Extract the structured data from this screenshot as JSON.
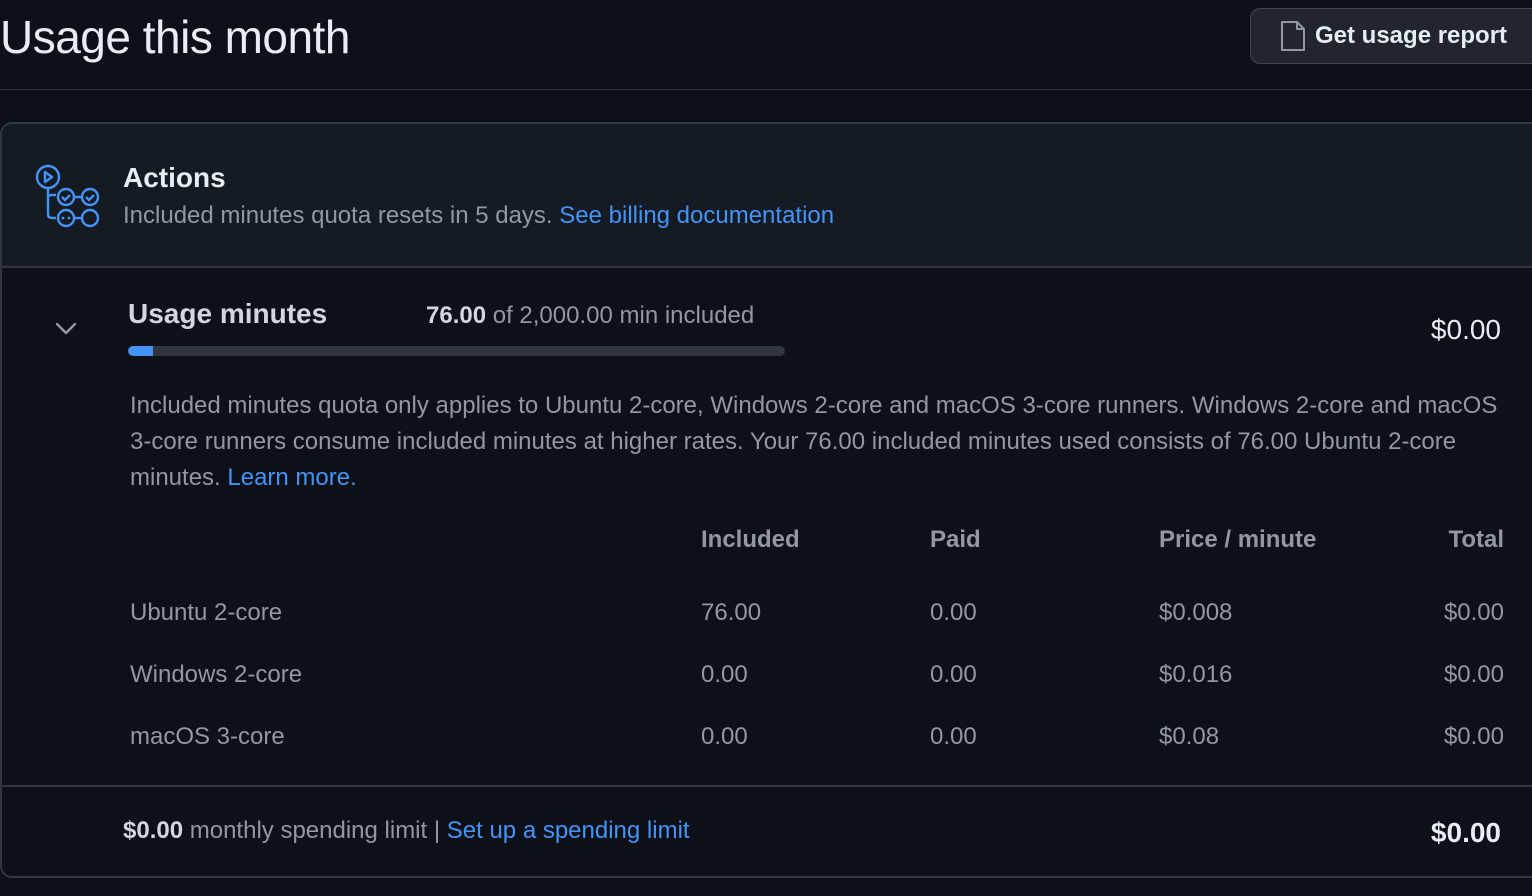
{
  "page": {
    "title": "Usage this month",
    "report_button_label": "Get usage report"
  },
  "actions": {
    "title": "Actions",
    "subtitle": "Included minutes quota resets in 5 days.",
    "doc_link": "See billing documentation"
  },
  "usage": {
    "title": "Usage minutes",
    "used": "76.00",
    "of_text": "of 2,000.00 min included",
    "progress_fraction": 0.038,
    "total": "$0.00",
    "description": "Included minutes quota only applies to Ubuntu 2-core, Windows 2-core and macOS 3-core runners. Windows 2-core and macOS 3-core runners consume included minutes at higher rates. Your 76.00 included minutes used consists of 76.00 Ubuntu 2-core minutes.",
    "learn_more": "Learn more."
  },
  "table": {
    "headers": {
      "included": "Included",
      "paid": "Paid",
      "price": "Price / minute",
      "total": "Total"
    },
    "rows": [
      {
        "name": "Ubuntu 2-core",
        "included": "76.00",
        "paid": "0.00",
        "price": "$0.008",
        "total": "$0.00"
      },
      {
        "name": "Windows 2-core",
        "included": "0.00",
        "paid": "0.00",
        "price": "$0.016",
        "total": "$0.00"
      },
      {
        "name": "macOS 3-core",
        "included": "0.00",
        "paid": "0.00",
        "price": "$0.08",
        "total": "$0.00"
      }
    ]
  },
  "footer": {
    "limit_amount": "$0.00",
    "limit_text": "monthly spending limit |",
    "limit_link": "Set up a spending limit",
    "total": "$0.00"
  },
  "colors": {
    "background": "#0d1117",
    "accent": "#4493f8",
    "border": "#30363d"
  },
  "icons": {
    "report": "file-icon",
    "actions": "workflow-icon",
    "collapse": "chevron-down-icon"
  }
}
